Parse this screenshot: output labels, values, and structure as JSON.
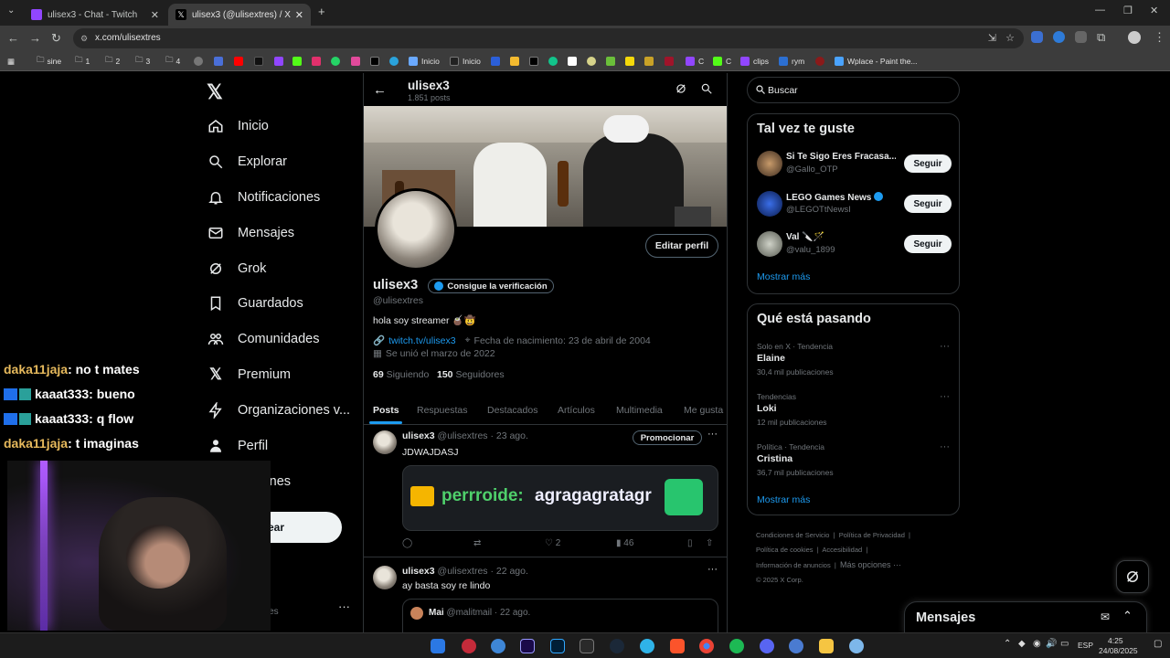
{
  "browser": {
    "tabs": [
      {
        "title": "ulisex3 - Chat - Twitch",
        "active": false
      },
      {
        "title": "ulisex3 (@ulisextres) / X",
        "active": true
      }
    ],
    "url": "x.com/ulisextres",
    "bookmarks": [
      "sine",
      "1",
      "2",
      "3",
      "4",
      "Inicio",
      "Inicio",
      "C",
      "C",
      "clips",
      "rym",
      "Wplace - Paint the..."
    ]
  },
  "nav": {
    "items": [
      "Inicio",
      "Explorar",
      "Notificaciones",
      "Mensajes",
      "Grok",
      "Guardados",
      "Comunidades",
      "Premium",
      "Organizaciones v...",
      "Perfil",
      "opciones"
    ],
    "post_button": "tear",
    "account_partial": "tres"
  },
  "chat_overlay": [
    {
      "user": "daka11jaja",
      "text": ": no t mates",
      "color": "#e6b95c",
      "badge": false
    },
    {
      "user": "kaaat333",
      "text": ": bueno",
      "color": "#ffffff",
      "badge": true
    },
    {
      "user": "kaaat333",
      "text": ": q flow",
      "color": "#ffffff",
      "badge": true
    },
    {
      "user": "daka11jaja",
      "text": ": t imaginas",
      "color": "#e6b95c",
      "badge": false
    }
  ],
  "profile": {
    "header_name": "ulisex3",
    "post_count": "1.851 posts",
    "name": "ulisex3",
    "verify_label": "Consigue la verificación",
    "handle": "@ulisextres",
    "bio": "hola soy streamer 🧉🤠",
    "link": "twitch.tv/ulisex3",
    "birthday": "Fecha de nacimiento: 23 de abril de 2004",
    "joined": "Se unió el marzo de 2022",
    "following_count": "69",
    "following_label": "Siguiendo",
    "followers_count": "150",
    "followers_label": "Seguidores",
    "edit_button": "Editar perfil",
    "tabs": [
      "Posts",
      "Respuestas",
      "Destacados",
      "Artículos",
      "Multimedia",
      "Me gusta"
    ]
  },
  "posts": [
    {
      "name": "ulisex3",
      "meta": "@ulisextres · 23 ago.",
      "promote": "Promocionar",
      "text": "JDWAJDASJ",
      "embed_user": "perrroide:",
      "embed_text": "agragagratagr",
      "likes": "2",
      "views": "46"
    },
    {
      "name": "ulisex3",
      "meta": "@ulisextres · 22 ago.",
      "text": "ay basta soy re lindo",
      "quote_name": "Mai",
      "quote_meta": "@malitmail · 22 ago."
    }
  ],
  "sidebar": {
    "search_placeholder": "Buscar",
    "suggest_title": "Tal vez te guste",
    "suggestions": [
      {
        "name": "Si Te Sigo Eres Fracasa...",
        "handle": "@Gallo_OTP",
        "button": "Seguir"
      },
      {
        "name": "LEGO Games News",
        "handle": "@LEGOTtNewsI",
        "button": "Seguir"
      },
      {
        "name": "Val 🔪🪄",
        "handle": "@valu_1899",
        "button": "Seguir"
      }
    ],
    "show_more": "Mostrar más",
    "trends_title": "Qué está pasando",
    "trends": [
      {
        "context": "Solo en X · Tendencia",
        "name": "Elaine",
        "count": "30,4 mil publicaciones"
      },
      {
        "context": "Tendencias",
        "name": "Loki",
        "count": "12 mil publicaciones"
      },
      {
        "context": "Política · Tendencia",
        "name": "Cristina",
        "count": "36,7 mil publicaciones"
      }
    ],
    "trends_more": "Mostrar más",
    "footer": [
      "Condiciones de Servicio",
      "Política de Privacidad",
      "Política de cookies",
      "Accesibilidad",
      "Información de anuncios",
      "Más opciones ···",
      "© 2025 X Corp."
    ],
    "messages_title": "Mensajes"
  },
  "system": {
    "lang": "ESP",
    "time": "4:25",
    "date": "24/08/2025"
  }
}
